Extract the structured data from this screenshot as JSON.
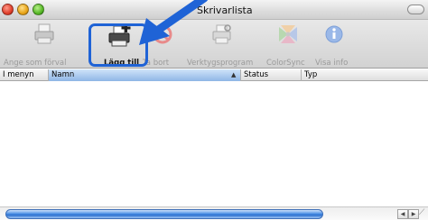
{
  "window": {
    "title": "Skrivarlista"
  },
  "toolbar": {
    "items": [
      {
        "label": "Ange som förval",
        "icon": "default-printer-icon",
        "enabled": false
      },
      {
        "label": "Lägg till",
        "icon": "add-printer-icon",
        "enabled": true
      },
      {
        "label": "Ta bort",
        "icon": "delete-icon",
        "enabled": false
      },
      {
        "label": "Verktygsprogram",
        "icon": "utility-icon",
        "enabled": false
      },
      {
        "label": "ColorSync",
        "icon": "colorsync-icon",
        "enabled": false
      },
      {
        "label": "Visa info",
        "icon": "info-icon",
        "enabled": false
      }
    ]
  },
  "columns": {
    "in_menu": "I menyn",
    "name": "Namn",
    "status": "Status",
    "type": "Typ"
  },
  "colors": {
    "highlight": "#1f63d6",
    "arrow": "#1f63d6",
    "column_selected": "#9cc0ea"
  }
}
